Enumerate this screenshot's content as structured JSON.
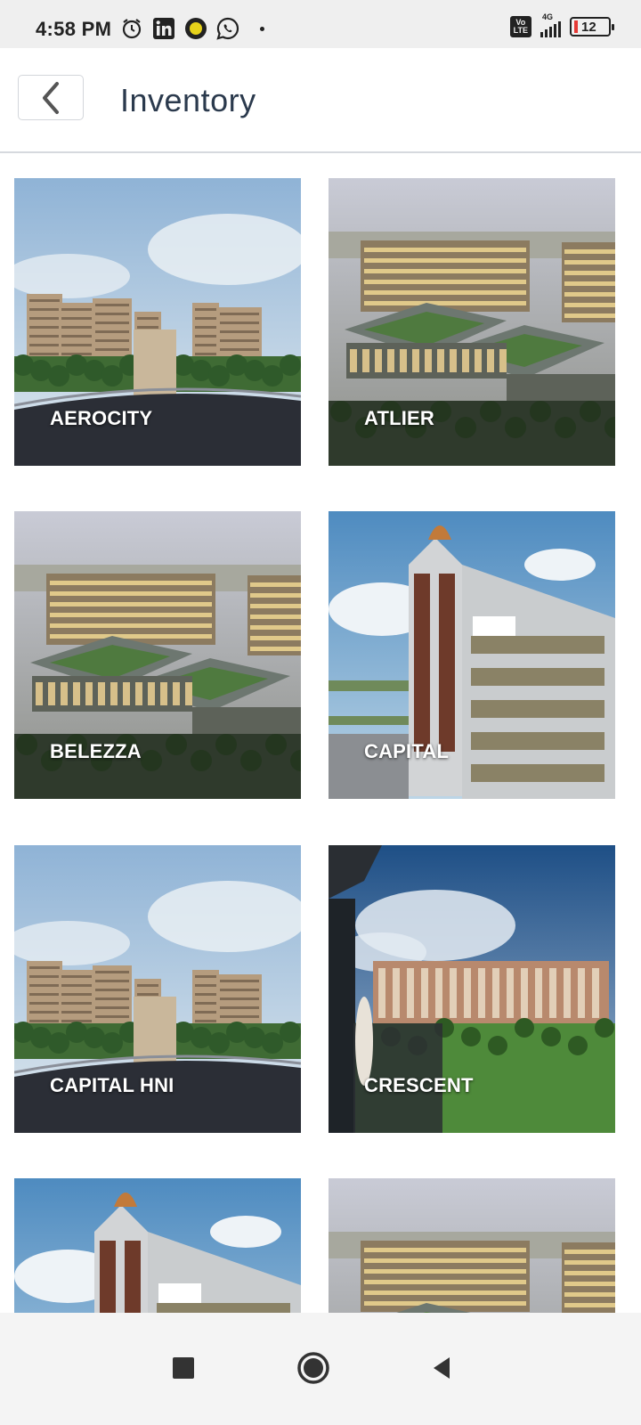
{
  "status_bar": {
    "time": "4:58 PM",
    "network_tag": "4G",
    "volte_top": "Vo",
    "volte_bottom": "LTE",
    "battery": "12",
    "notification_icons": [
      "alarm-icon",
      "linkedin-icon",
      "app-icon",
      "whatsapp-icon"
    ]
  },
  "header": {
    "title": "Inventory",
    "back_icon": "chevron-left-icon"
  },
  "inventory": {
    "items": [
      {
        "label": "AEROCITY",
        "image": "residential-towers"
      },
      {
        "label": "ATLIER",
        "image": "commercial-complex"
      },
      {
        "label": "BELEZZA",
        "image": "commercial-complex"
      },
      {
        "label": "CAPITAL",
        "image": "lifestyle-mall"
      },
      {
        "label": "CAPITAL HNI",
        "image": "residential-towers"
      },
      {
        "label": "CRESCENT",
        "image": "balcony-view-complex"
      },
      {
        "label": "",
        "image": "lifestyle-mall"
      },
      {
        "label": "",
        "image": "commercial-complex"
      }
    ]
  },
  "nav_bar": {
    "recents_icon": "square-icon",
    "home_icon": "circle-icon",
    "back_icon": "triangle-back-icon"
  }
}
